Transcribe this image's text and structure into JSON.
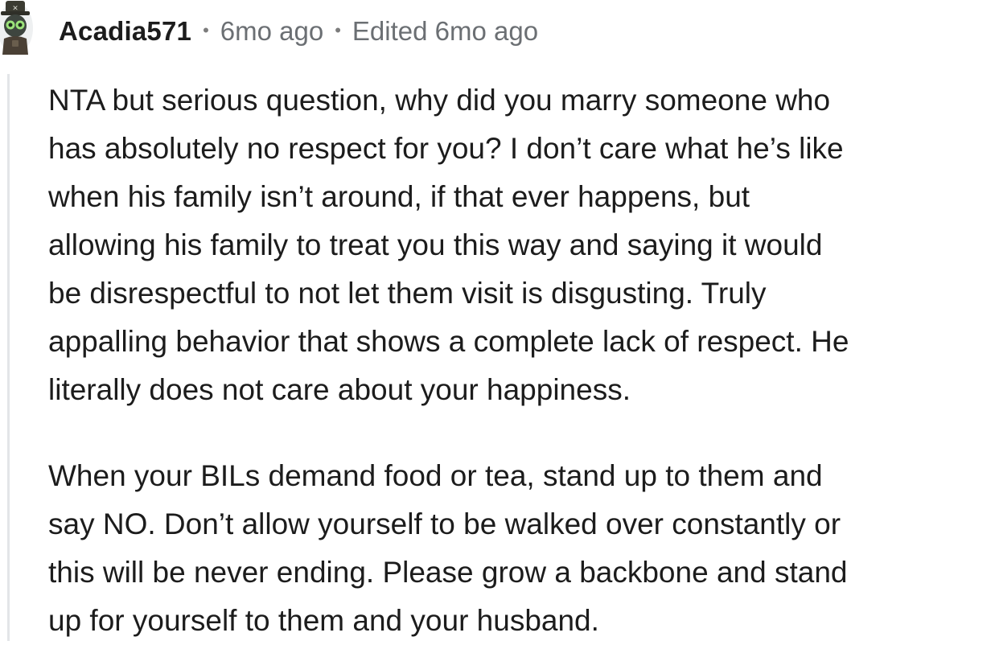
{
  "comment": {
    "author": "Acadia571",
    "separator": "•",
    "age": "6mo ago",
    "edited": "Edited 6mo ago",
    "avatar_icon": "robot-avatar-icon",
    "paragraphs": [
      {
        "lines": [
          "NTA but serious question, why did you marry someone who",
          "has absolutely no respect for you? I don’t care what he’s like",
          "when his family isn’t around, if that ever happens, but",
          "allowing his family to treat you this way and saying it would",
          "be disrespectful to not let them visit is disgusting. Truly",
          "appalling behavior that shows a complete lack of respect. He",
          "literally does not care about your happiness."
        ]
      },
      {
        "lines": [
          "When your BILs demand food or tea, stand up to them and",
          "say NO. Don’t allow yourself to be walked over constantly or",
          "this will be never ending. Please grow a backbone and stand",
          "up for yourself to them and your husband."
        ]
      }
    ]
  },
  "colors": {
    "text": "#1c1c1c",
    "muted": "#6b6f73",
    "thread_line": "#e3e5e8"
  }
}
